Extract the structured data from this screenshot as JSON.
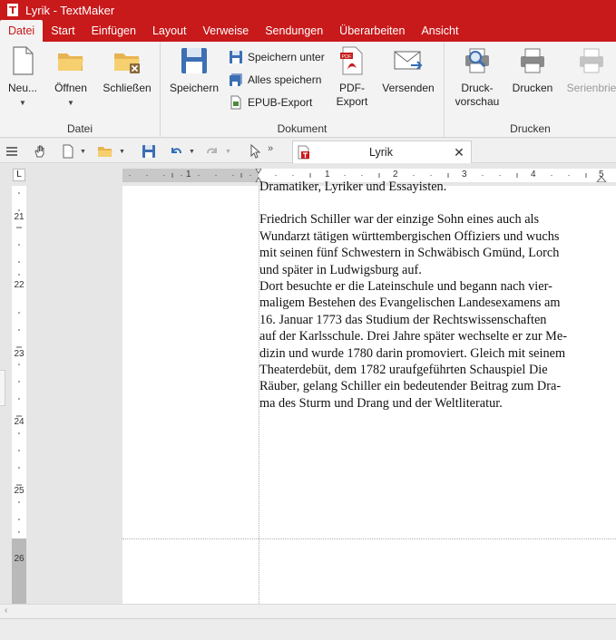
{
  "window": {
    "title": "Lyrik - TextMaker"
  },
  "menu": {
    "tabs": [
      "Datei",
      "Start",
      "Einfügen",
      "Layout",
      "Verweise",
      "Sendungen",
      "Überarbeiten",
      "Ansicht"
    ],
    "active": "Datei"
  },
  "ribbon": {
    "datei": {
      "label": "Datei",
      "neu": "Neu...",
      "oeffnen": "Öffnen",
      "schliessen": "Schließen"
    },
    "dokument": {
      "label": "Dokument",
      "speichern": "Speichern",
      "speichern_unter": "Speichern unter",
      "alles_speichern": "Alles speichern",
      "epub_export": "EPUB-Export",
      "pdf_export_1": "PDF-",
      "pdf_export_2": "Export",
      "versenden": "Versenden"
    },
    "drucken": {
      "label": "Drucken",
      "druckvorschau_1": "Druck-",
      "druckvorschau_2": "vorschau",
      "drucken": "Drucken",
      "serienbrief": "Serienbrie"
    }
  },
  "document_tab": {
    "title": "Lyrik",
    "close": "✕"
  },
  "ruler": {
    "horizontal_numbers": [
      "1",
      "1",
      "2",
      "3",
      "4",
      "5"
    ],
    "vertical_numbers": [
      "21",
      "22",
      "23",
      "24",
      "25",
      "26"
    ],
    "tab_marker": "L"
  },
  "document": {
    "cut_line": "Dramatiker, Lyriker und Essayisten.",
    "lines": [
      "Friedrich Schiller war der einzige Sohn eines auch als",
      "Wundarzt tätigen württembergischen Offiziers und wuchs",
      "mit seinen fünf Schwestern in Schwäbisch Gmünd, Lorch",
      "und später in Ludwigsburg auf.",
      "Dort besuchte er die Lateinschule und begann nach vier-",
      "maligem Bestehen des Evangelischen Landesexamens am",
      "16. Januar 1773 das Studium der Rechtswissenschaften",
      "auf der Karlsschule. Drei Jahre später wechselte er zur Me-",
      "dizin und wurde 1780 darin promoviert. Gleich mit seinem",
      "Theaterdebüt, dem 1782 uraufgeführten Schauspiel Die",
      "Räuber, gelang Schiller ein bedeutender Beitrag zum Dra-",
      "ma des Sturm und Drang und der Weltliteratur."
    ]
  },
  "colors": {
    "brand": "#c8191b",
    "ribbon": "#f3f3f3"
  }
}
